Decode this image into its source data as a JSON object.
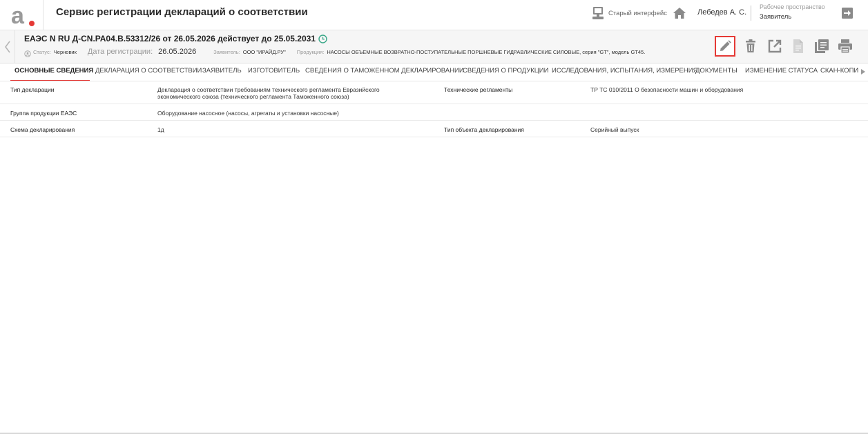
{
  "app": {
    "title": "Сервис регистрации деклараций о соответствии",
    "old_interface_label": "Старый интерфейс",
    "user_name": "Лебедев А. С.",
    "workspace_title": "Рабочее пространство",
    "workspace_value": "Заявитель"
  },
  "declaration": {
    "title": "ЕАЭС N RU Д-CN.РА04.В.53312/26 от 26.05.2026 действует до 25.05.2031",
    "status_label": "Статус:",
    "status_value": "Черновик",
    "reg_date_label": "Дата регистрации:",
    "reg_date_value": "26.05.2026",
    "applicant_label": "Заявитель:",
    "applicant_value": "ООО \"ИРАЙД.РУ\"",
    "product_label": "Продукция:",
    "product_value": "НАСОСЫ ОБЪЕМНЫЕ ВОЗВРАТНО-ПОСТУПАТЕЛЬНЫЕ ПОРШНЕВЫЕ ГИДРАВЛИЧЕСКИЕ СИЛОВЫЕ, серия \"GT\", модель GT45."
  },
  "toolbar": {
    "icons": [
      "edit-icon",
      "delete-icon",
      "open-external-icon",
      "document-icon",
      "copy-icon",
      "print-icon"
    ],
    "highlight_color": "#e53935"
  },
  "tabs": [
    {
      "label": "ОСНОВНЫЕ СВЕДЕНИЯ",
      "active": true
    },
    {
      "label": "ДЕКЛАРАЦИЯ О СООТВЕТСТВИИ"
    },
    {
      "label": "ЗАЯВИТЕЛЬ"
    },
    {
      "label": "ИЗГОТОВИТЕЛЬ"
    },
    {
      "label": "СВЕДЕНИЯ О ТАМОЖЕННОМ ДЕКЛАРИРОВАНИИ"
    },
    {
      "label": "СВЕДЕНИЯ О ПРОДУКЦИИ"
    },
    {
      "label": "ИССЛЕДОВАНИЯ, ИСПЫТАНИЯ, ИЗМЕРЕНИЯ"
    },
    {
      "label": "ДОКУМЕНТЫ"
    },
    {
      "label": "ИЗМЕНЕНИЕ СТАТУСА"
    },
    {
      "label": "СКАН-КОПИИ"
    }
  ],
  "info": {
    "declaration_type_label": "Тип декларации",
    "declaration_type_value": "Декларация о соответствии требованиям технического регламента Евразийского экономического союза (технического регламента Таможенного союза)",
    "tech_regulations_label": "Технические регламенты",
    "tech_regulations_value": "ТР ТС 010/2011 О безопасности машин и оборудования",
    "product_group_label": "Группа продукции ЕАЭС",
    "product_group_value": "Оборудование насосное (насосы, агрегаты и установки насосные)",
    "scheme_label": "Схема декларирования",
    "scheme_value": "1д",
    "object_type_label": "Тип объекта декларирования",
    "object_type_value": "Серийный выпуск"
  },
  "colors": {
    "accent": "#e53935",
    "icon_gray": "#8a8a8a",
    "clock": "#3aa889",
    "logo": "#9a9a9a"
  }
}
